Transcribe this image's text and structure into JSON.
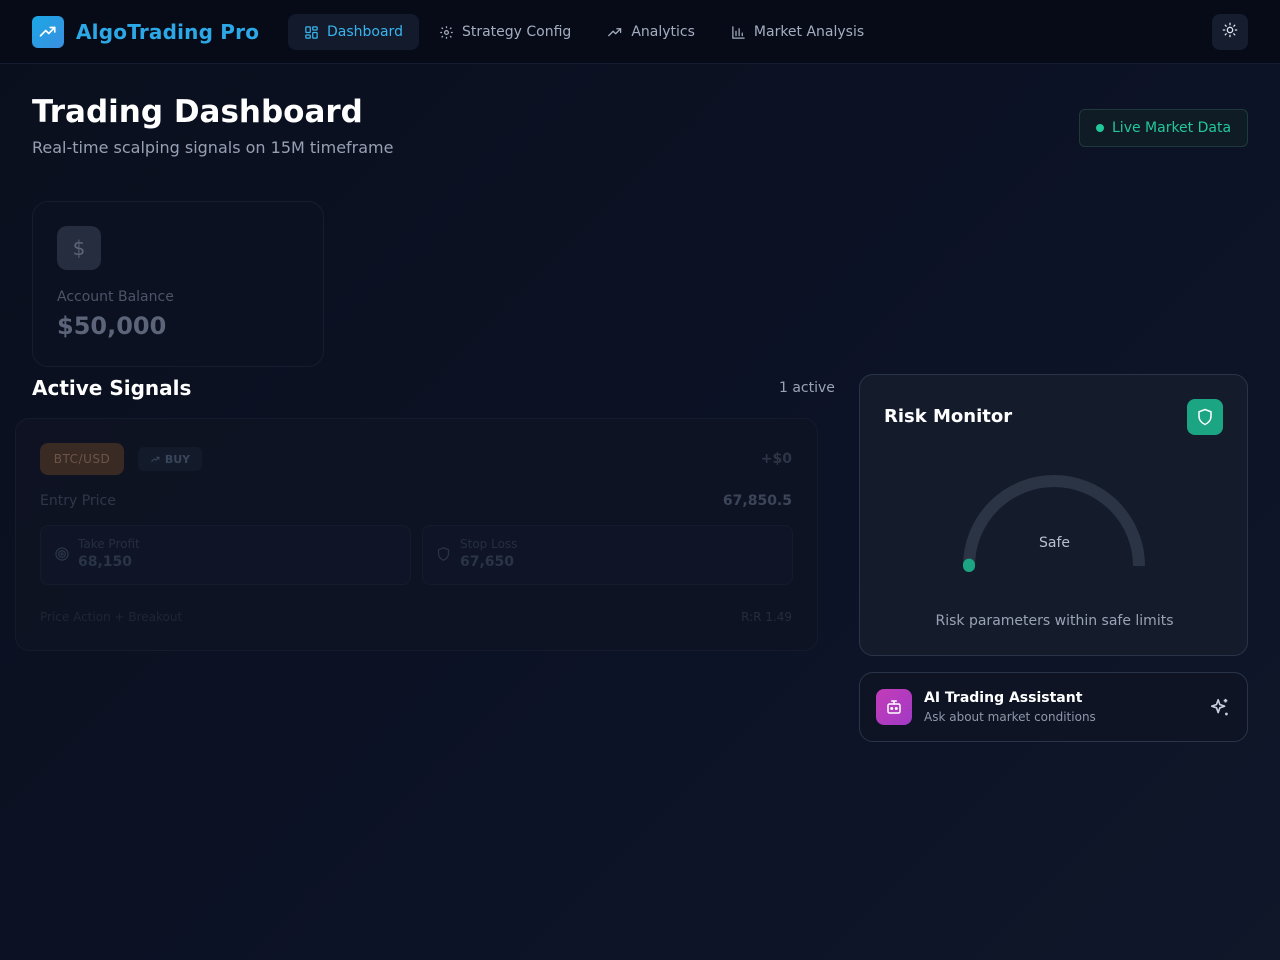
{
  "app": {
    "name": "AlgoTrading Pro",
    "brand_icon": "trending-up-icon",
    "accent_color": "#2da8e6"
  },
  "nav": {
    "items": [
      {
        "label": "Dashboard",
        "icon": "dashboard-grid-icon",
        "active": true
      },
      {
        "label": "Strategy Config",
        "icon": "gear-icon",
        "active": false
      },
      {
        "label": "Analytics",
        "icon": "trending-up-icon",
        "active": false
      },
      {
        "label": "Market Analysis",
        "icon": "bar-chart-icon",
        "active": false
      }
    ],
    "theme_toggle_icon": "sun-icon"
  },
  "header": {
    "title": "Trading Dashboard",
    "subtitle": "Real-time scalping signals on 15M timeframe",
    "live_badge": "Live Market Data",
    "live_color": "#22c79a"
  },
  "balance": {
    "icon": "dollar-icon",
    "label": "Account Balance",
    "value": "$50,000"
  },
  "signals": {
    "title": "Active Signals",
    "count_label": "1 active",
    "items": [
      {
        "pair": "BTC/USD",
        "side": "BUY",
        "pnl": "+$0",
        "entry_label": "Entry Price",
        "entry_value": "67,850.5",
        "take_profit_label": "Take Profit",
        "take_profit_value": "68,150",
        "stop_loss_label": "Stop Loss",
        "stop_loss_value": "67,650",
        "strategy": "Price Action + Breakout",
        "risk_reward": "R:R 1.49"
      }
    ]
  },
  "risk": {
    "title": "Risk Monitor",
    "icon": "shield-icon",
    "status": "Safe",
    "level": 0.0,
    "note": "Risk parameters within safe limits",
    "safe_color": "#1ba583"
  },
  "assistant": {
    "title": "AI Trading Assistant",
    "subtitle": "Ask about market conditions",
    "icon": "bot-icon",
    "action_icon": "sparkles-icon"
  }
}
